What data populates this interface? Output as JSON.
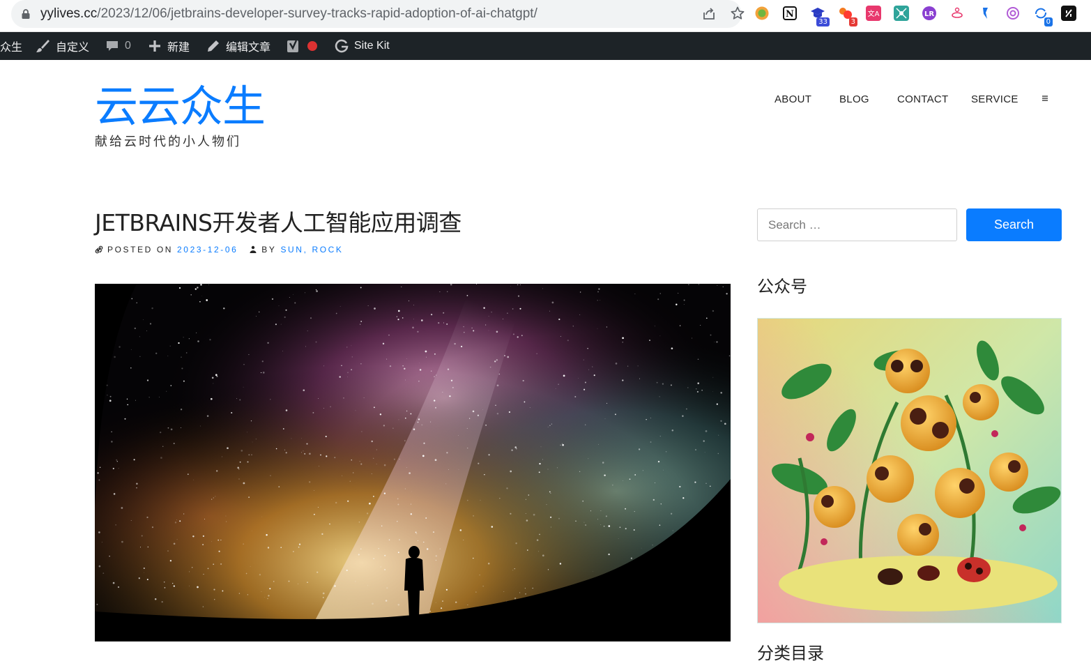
{
  "browser": {
    "url_host": "yylives.cc",
    "url_path": "/2023/12/06/jetbrains-developer-survey-tracks-rapid-adoption-of-ai-chatgpt/",
    "extension_badges": {
      "ext3": "33",
      "ext4": "3",
      "ext13": "0"
    }
  },
  "adminbar": {
    "site_name": "众生",
    "customize": "自定义",
    "comments_count": "0",
    "new": "新建",
    "edit_post": "编辑文章",
    "site_kit": "Site Kit"
  },
  "header": {
    "site_title": "云云众生",
    "tagline": "献给云时代的小人物们",
    "nav": [
      "ABOUT",
      "BLOG",
      "CONTACT",
      "SERVICE"
    ]
  },
  "post": {
    "title": "JETBRAINS开发者人工智能应用调查",
    "posted_on_label": "POSTED ON",
    "date": "2023-12-06",
    "by_label": "BY",
    "authors": "SUN, ROCK"
  },
  "sidebar": {
    "search_placeholder": "Search …",
    "search_button": "Search",
    "widget1_title": "公众号",
    "widget2_title": "分类目录"
  },
  "colors": {
    "accent": "#0a7cff",
    "adminbar": "#1d2327"
  }
}
